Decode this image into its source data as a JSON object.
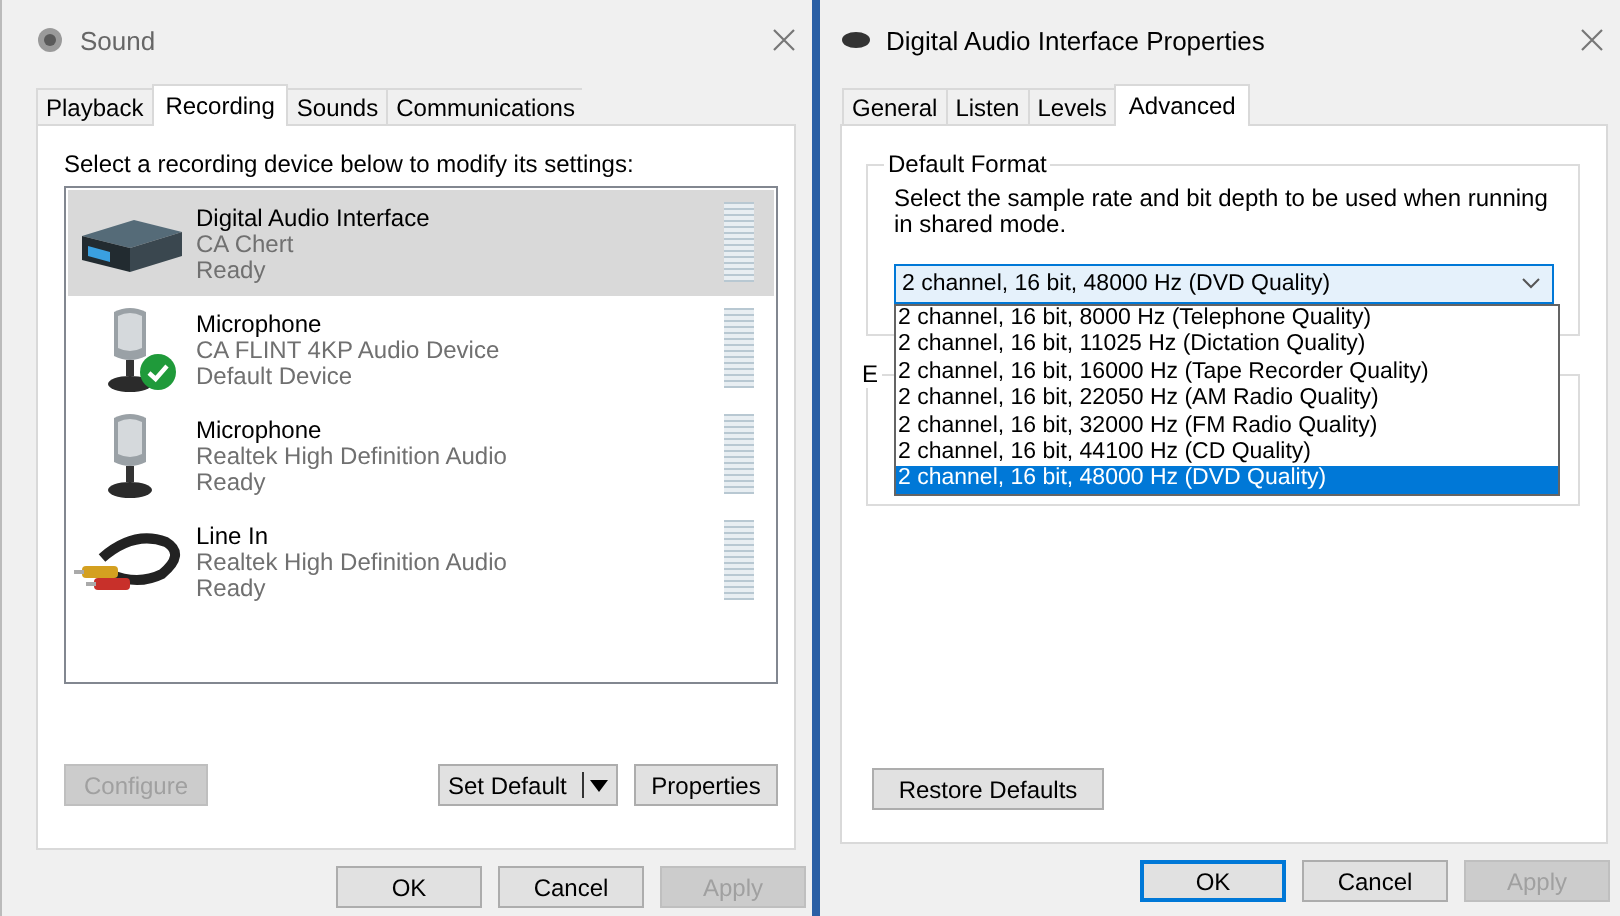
{
  "sound": {
    "title": "Sound",
    "tabs": [
      {
        "label": "Playback",
        "selected": false
      },
      {
        "label": "Recording",
        "selected": true
      },
      {
        "label": "Sounds",
        "selected": false
      },
      {
        "label": "Communications",
        "selected": false
      }
    ],
    "instruction": "Select a recording device below to modify its settings:",
    "devices": [
      {
        "kind": "interface",
        "name": "Digital Audio Interface",
        "detail": "CA Chert",
        "status": "Ready",
        "selected": true,
        "is_default": false
      },
      {
        "kind": "microphone",
        "name": "Microphone",
        "detail": "CA FLINT 4KP Audio Device",
        "status": "Default Device",
        "selected": false,
        "is_default": true
      },
      {
        "kind": "microphone",
        "name": "Microphone",
        "detail": "Realtek High Definition Audio",
        "status": "Ready",
        "selected": false,
        "is_default": false
      },
      {
        "kind": "line-in",
        "name": "Line In",
        "detail": "Realtek High Definition Audio",
        "status": "Ready",
        "selected": false,
        "is_default": false
      }
    ],
    "actions": [
      {
        "kind": "plain",
        "label": "Configure",
        "disabled": true
      },
      {
        "kind": "split",
        "label": "Set Default",
        "disabled": false
      },
      {
        "kind": "plain",
        "label": "Properties",
        "disabled": false
      }
    ],
    "footer": [
      {
        "label": "OK",
        "disabled": false,
        "focused": false
      },
      {
        "label": "Cancel",
        "disabled": false,
        "focused": false
      },
      {
        "label": "Apply",
        "disabled": true,
        "focused": false
      }
    ]
  },
  "properties": {
    "title": "Digital Audio Interface Properties",
    "tabs": [
      {
        "label": "General",
        "selected": false
      },
      {
        "label": "Listen",
        "selected": false
      },
      {
        "label": "Levels",
        "selected": false
      },
      {
        "label": "Advanced",
        "selected": true
      }
    ],
    "format_group": {
      "legend": "Default Format",
      "description": "Select the sample rate and bit depth to be used when running in shared mode.",
      "dropdown": {
        "value": "2 channel, 16 bit, 48000 Hz (DVD Quality)",
        "expanded": true,
        "options": [
          {
            "label": "2 channel, 16 bit, 8000 Hz (Telephone Quality)",
            "selected": false
          },
          {
            "label": "2 channel, 16 bit, 11025 Hz (Dictation Quality)",
            "selected": false
          },
          {
            "label": "2 channel, 16 bit, 16000 Hz (Tape Recorder Quality)",
            "selected": false
          },
          {
            "label": "2 channel, 16 bit, 22050 Hz (AM Radio Quality)",
            "selected": false
          },
          {
            "label": "2 channel, 16 bit, 32000 Hz (FM Radio Quality)",
            "selected": false
          },
          {
            "label": "2 channel, 16 bit, 44100 Hz (CD Quality)",
            "selected": false
          },
          {
            "label": "2 channel, 16 bit, 48000 Hz (DVD Quality)",
            "selected": true
          }
        ]
      }
    },
    "second_group": {
      "legend": "E"
    },
    "restore_button": {
      "label": "Restore Defaults"
    },
    "footer": [
      {
        "label": "OK",
        "disabled": false,
        "focused": true
      },
      {
        "label": "Cancel",
        "disabled": false,
        "focused": false
      },
      {
        "label": "Apply",
        "disabled": true,
        "focused": false
      }
    ]
  }
}
